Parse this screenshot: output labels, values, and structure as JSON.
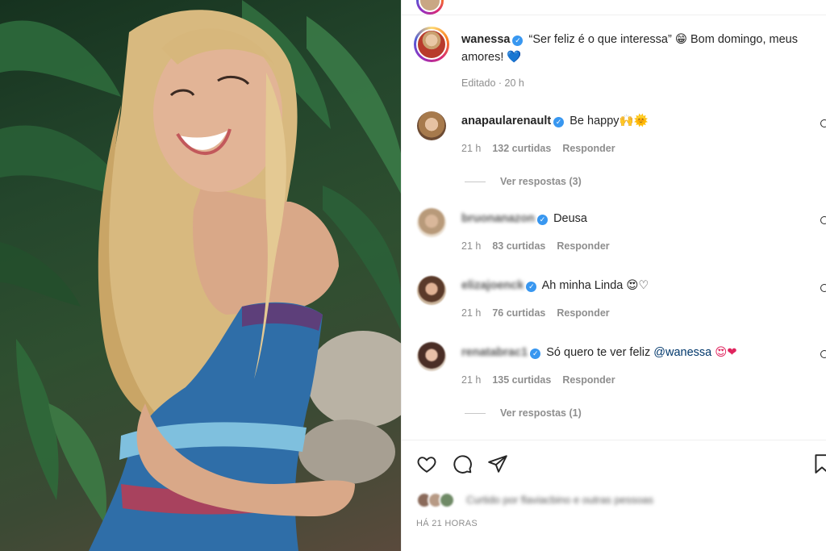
{
  "post": {
    "author": "wanessa",
    "caption": "“Ser feliz é o que interessa” 😁 Bom domingo, meus amores! 💙",
    "caption_main": "“Ser feliz é o que interessa”",
    "caption_emoji": "😁",
    "caption_rest": "Bom domingo, meus amores!",
    "caption_heart": "💙",
    "edited": "Editado · 20 h",
    "date": "HÁ 21 HORAS",
    "liked_by": "Curtido por flaviacbino e outras pessoas"
  },
  "comments": [
    {
      "username": "anapaularenault",
      "text": "Be happy",
      "emoji": "🙌🌞",
      "time": "21 h",
      "likes": "132 curtidas",
      "reply": "Responder",
      "view_replies": "Ver respostas (3)"
    },
    {
      "username": "bruonanazon",
      "text": "Deusa",
      "time": "21 h",
      "likes": "83 curtidas",
      "reply": "Responder"
    },
    {
      "username": "elizajoenck",
      "text": "Ah minha Linda",
      "emoji": "😍♡",
      "time": "21 h",
      "likes": "76 curtidas",
      "reply": "Responder"
    },
    {
      "username": "renatabrac1",
      "text": "Só quero te ver feliz",
      "mention": "@wanessa",
      "emoji": "😍❤",
      "time": "21 h",
      "likes": "135 curtidas",
      "reply": "Responder",
      "view_replies": "Ver respostas (1)"
    }
  ],
  "icons": {
    "like": "heart-icon",
    "comment": "comment-icon",
    "share": "send-icon",
    "save": "bookmark-icon",
    "verified": "verified-badge-icon"
  },
  "colors": {
    "link": "#00376b",
    "verified": "#3897f0",
    "muted": "#8e8e8e",
    "text": "#262626"
  }
}
